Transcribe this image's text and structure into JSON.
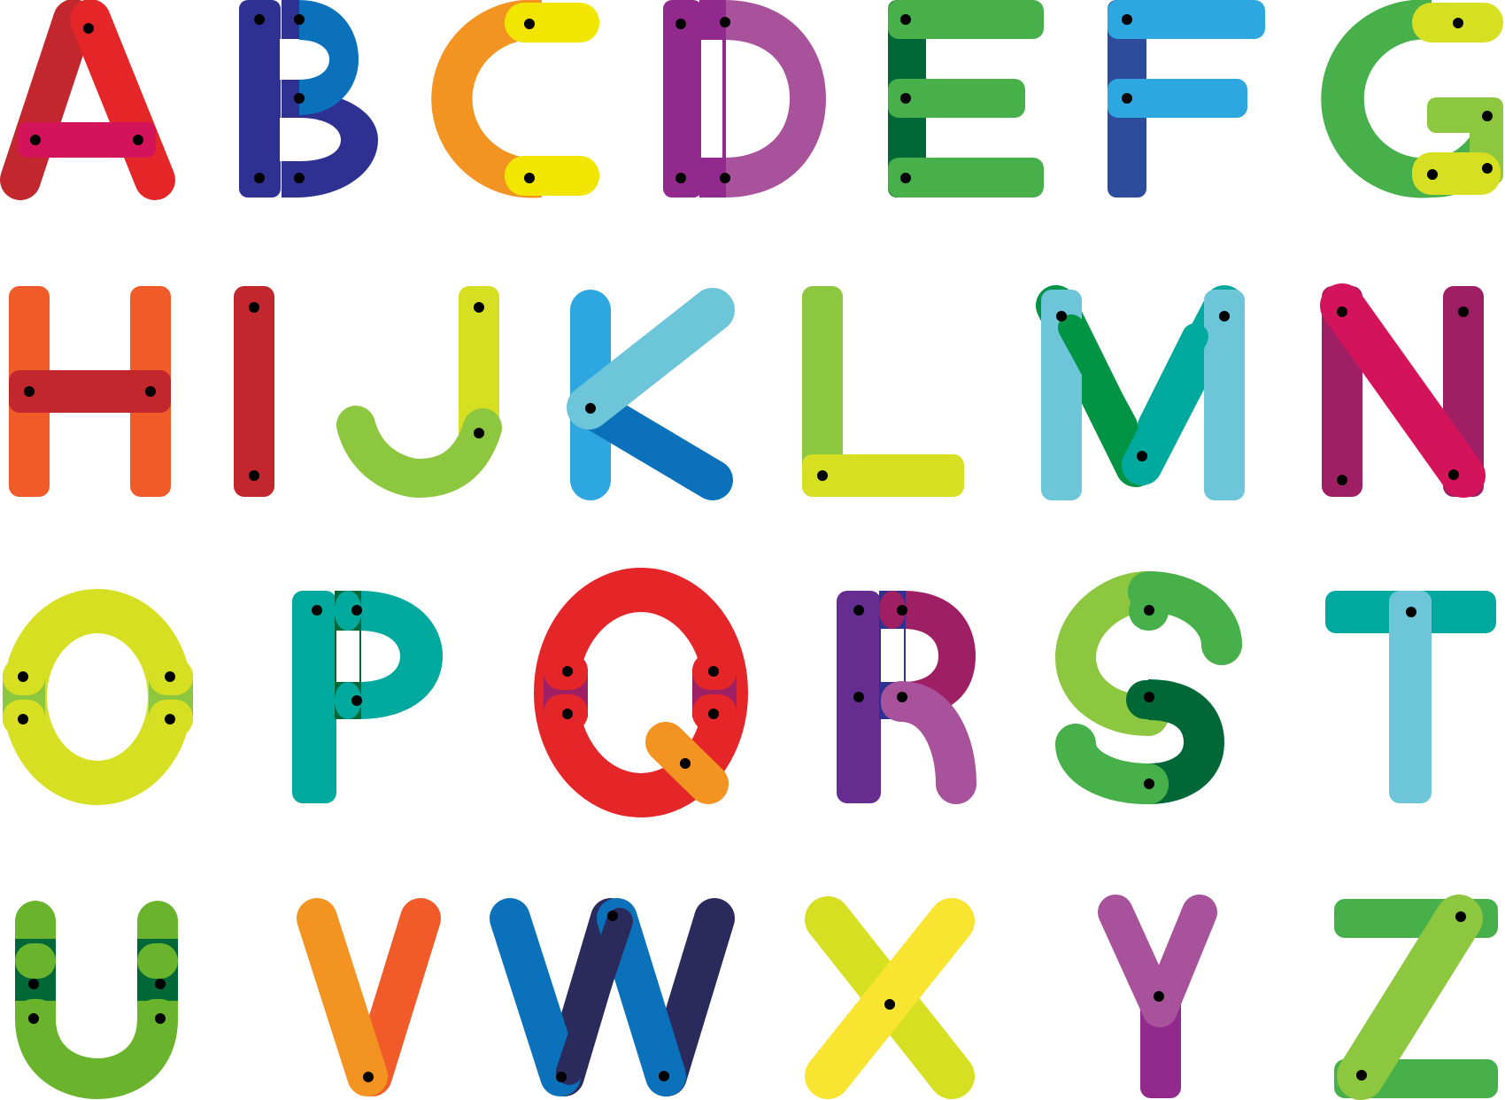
{
  "letters": [
    {
      "char": "A",
      "name": "letter-a-block",
      "colors": [
        "#C1272D",
        "#E52629",
        "#D4145A"
      ]
    },
    {
      "char": "B",
      "name": "letter-b-block",
      "colors": [
        "#2E3192",
        "#0B71BB"
      ]
    },
    {
      "char": "C",
      "name": "letter-c-block",
      "colors": [
        "#F39422",
        "#F2E500"
      ]
    },
    {
      "char": "D",
      "name": "letter-d-block",
      "colors": [
        "#92298D",
        "#A8529C"
      ]
    },
    {
      "char": "E",
      "name": "letter-e-block",
      "colors": [
        "#006837",
        "#47B04B"
      ]
    },
    {
      "char": "F",
      "name": "letter-f-block",
      "colors": [
        "#2E4C9C",
        "#2EA7E0"
      ]
    },
    {
      "char": "G",
      "name": "letter-g-block",
      "colors": [
        "#47B04B",
        "#D7DF23",
        "#8DC63F"
      ]
    },
    {
      "char": "H",
      "name": "letter-h-block",
      "colors": [
        "#F15A29",
        "#C1272D"
      ]
    },
    {
      "char": "I",
      "name": "letter-i-block",
      "colors": [
        "#C1272D"
      ]
    },
    {
      "char": "J",
      "name": "letter-j-block",
      "colors": [
        "#D7DF23",
        "#8DC63F"
      ]
    },
    {
      "char": "K",
      "name": "letter-k-block",
      "colors": [
        "#2EA7E0",
        "#0B71BB",
        "#6CC5D9"
      ]
    },
    {
      "char": "L",
      "name": "letter-l-block",
      "colors": [
        "#8DC63F",
        "#D7DF23"
      ]
    },
    {
      "char": "M",
      "name": "letter-m-block",
      "colors": [
        "#6CC5D9",
        "#009444",
        "#00A99D"
      ]
    },
    {
      "char": "N",
      "name": "letter-n-block",
      "colors": [
        "#9E1F63",
        "#D4145A"
      ]
    },
    {
      "char": "O",
      "name": "letter-o-block",
      "colors": [
        "#D7DF23",
        "#8DC63F"
      ]
    },
    {
      "char": "P",
      "name": "letter-p-block",
      "colors": [
        "#00A99D",
        "#006837"
      ]
    },
    {
      "char": "Q",
      "name": "letter-q-block",
      "colors": [
        "#E52629",
        "#9E1F63",
        "#F39422"
      ]
    },
    {
      "char": "R",
      "name": "letter-r-block",
      "colors": [
        "#662D91",
        "#9E1F63",
        "#A8529C"
      ]
    },
    {
      "char": "S",
      "name": "letter-s-block",
      "colors": [
        "#8DC63F",
        "#47B04B",
        "#006837"
      ]
    },
    {
      "char": "T",
      "name": "letter-t-block",
      "colors": [
        "#00A99D",
        "#6CC5D9"
      ]
    },
    {
      "char": "U",
      "name": "letter-u-block",
      "colors": [
        "#6AB42D",
        "#006837"
      ]
    },
    {
      "char": "V",
      "name": "letter-v-block",
      "colors": [
        "#F15A29",
        "#F39422"
      ]
    },
    {
      "char": "W",
      "name": "letter-w-block",
      "colors": [
        "#0B71BB",
        "#2B2A5C"
      ]
    },
    {
      "char": "X",
      "name": "letter-x-block",
      "colors": [
        "#D7DF23",
        "#F9E531"
      ]
    },
    {
      "char": "Y",
      "name": "letter-y-block",
      "colors": [
        "#92298D",
        "#A8529C"
      ]
    },
    {
      "char": "Z",
      "name": "letter-z-block",
      "colors": [
        "#47B04B",
        "#8DC63F"
      ]
    }
  ]
}
